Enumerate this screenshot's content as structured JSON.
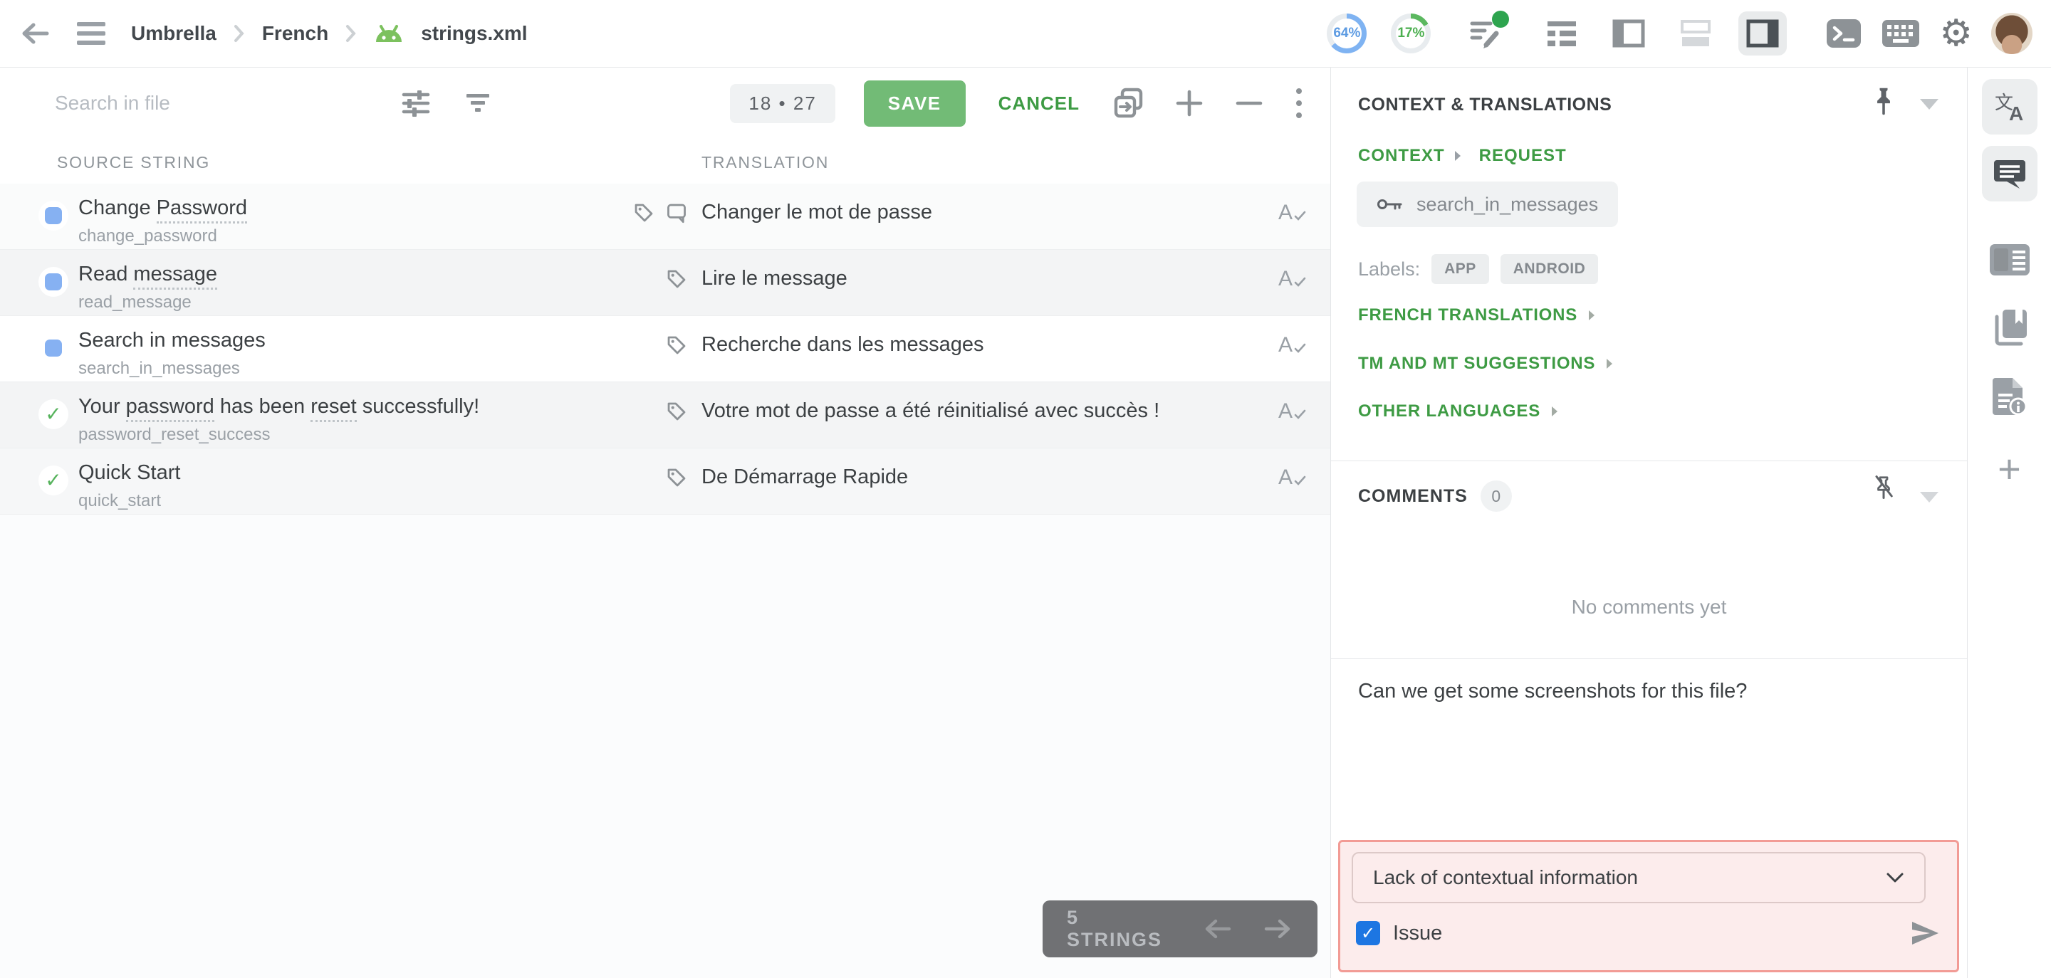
{
  "topbar": {
    "breadcrumb": [
      "Umbrella",
      "French",
      "strings.xml"
    ],
    "progress": [
      {
        "value": "64%",
        "color": "#7fb3f2"
      },
      {
        "value": "17%",
        "color": "#5cb860"
      }
    ]
  },
  "toolbar": {
    "search_placeholder": "Search in file",
    "counter": "18 • 27",
    "save_label": "SAVE",
    "cancel_label": "CANCEL"
  },
  "table": {
    "source_header": "SOURCE STRING",
    "translation_header": "TRANSLATION"
  },
  "rows": [
    {
      "source_parts": [
        "Change ",
        "Password"
      ],
      "key": "change_password",
      "translation": "Changer le mot de passe",
      "status": "translated"
    },
    {
      "source_parts": [
        "Read ",
        "message"
      ],
      "key": "read_message",
      "translation": "Lire le message",
      "status": "translated"
    },
    {
      "source_parts": [
        "Search in messages"
      ],
      "key": "search_in_messages",
      "translation": "Recherche dans les messages",
      "status": "translated"
    },
    {
      "source_parts": [
        "Your ",
        "password",
        " has been ",
        "reset",
        " successfully!"
      ],
      "key": "password_reset_success",
      "translation": "Votre mot de passe a été réinitialisé avec succès !",
      "status": "approved"
    },
    {
      "source_parts": [
        "Quick Start"
      ],
      "key": "quick_start",
      "translation": "De Démarrage Rapide",
      "status": "approved"
    }
  ],
  "pager": {
    "label": "5 STRINGS"
  },
  "panel": {
    "title": "CONTEXT & TRANSLATIONS",
    "tabs": {
      "context": "CONTEXT",
      "request": "REQUEST"
    },
    "key": "search_in_messages",
    "labels_caption": "Labels:",
    "labels": [
      "APP",
      "ANDROID"
    ],
    "sections": [
      "FRENCH TRANSLATIONS",
      "TM AND MT SUGGESTIONS",
      "OTHER LANGUAGES"
    ],
    "comments": {
      "title": "COMMENTS",
      "count": "0",
      "empty": "No comments yet"
    },
    "composer": {
      "text": "Can we get some screenshots for this file?"
    },
    "issue": {
      "type": "Lack of contextual information",
      "checkbox_label": "Issue"
    }
  }
}
